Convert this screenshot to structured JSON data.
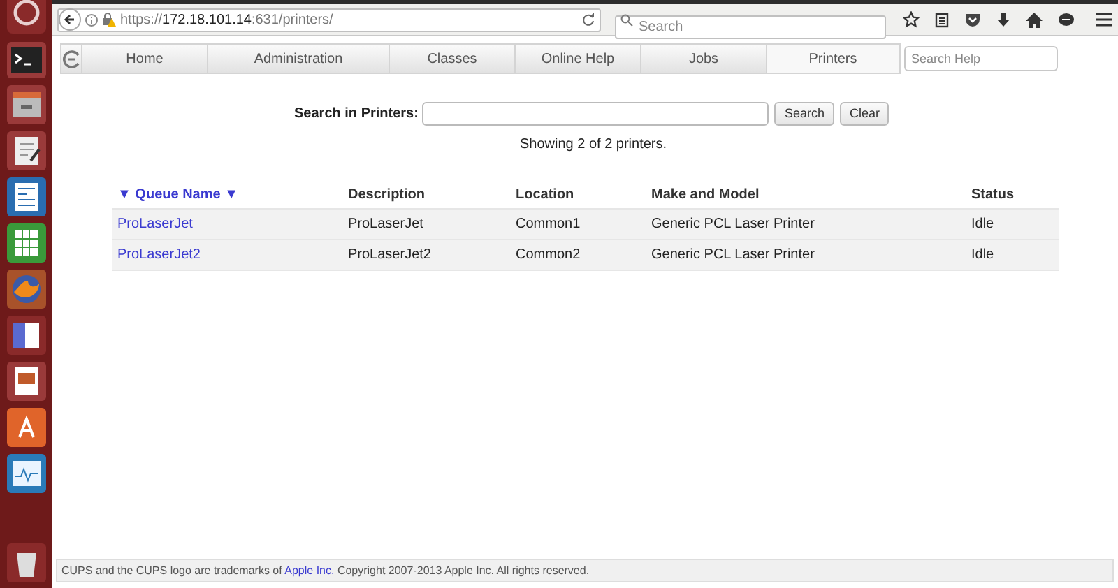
{
  "browser": {
    "url_prefix": "https://",
    "url_host": "172.18.101.14",
    "url_rest": ":631/printers/",
    "search_placeholder": "Search"
  },
  "nav": {
    "tabs": [
      {
        "label": "Home",
        "selected": false
      },
      {
        "label": "Administration",
        "selected": false
      },
      {
        "label": "Classes",
        "selected": false
      },
      {
        "label": "Online Help",
        "selected": false
      },
      {
        "label": "Jobs",
        "selected": false
      },
      {
        "label": "Printers",
        "selected": true
      }
    ],
    "search_placeholder": "Search Help"
  },
  "search": {
    "label": "Search in Printers:",
    "buttons": [
      "Search",
      "Clear"
    ]
  },
  "summary": "Showing 2 of 2 printers.",
  "table": {
    "sort_mark": "▼",
    "columns": [
      "Queue Name",
      "Description",
      "Location",
      "Make and Model",
      "Status"
    ],
    "rows": [
      [
        "ProLaserJet",
        "ProLaserJet",
        "Common1",
        "Generic PCL Laser Printer",
        "Idle"
      ],
      [
        "ProLaserJet2",
        "ProLaserJet2",
        "Common2",
        "Generic PCL Laser Printer",
        "Idle"
      ]
    ]
  },
  "footer": {
    "before": "CUPS and the CUPS logo are trademarks of ",
    "link": "Apple Inc.",
    "after": " Copyright 2007-2013 Apple Inc. All rights reserved."
  }
}
